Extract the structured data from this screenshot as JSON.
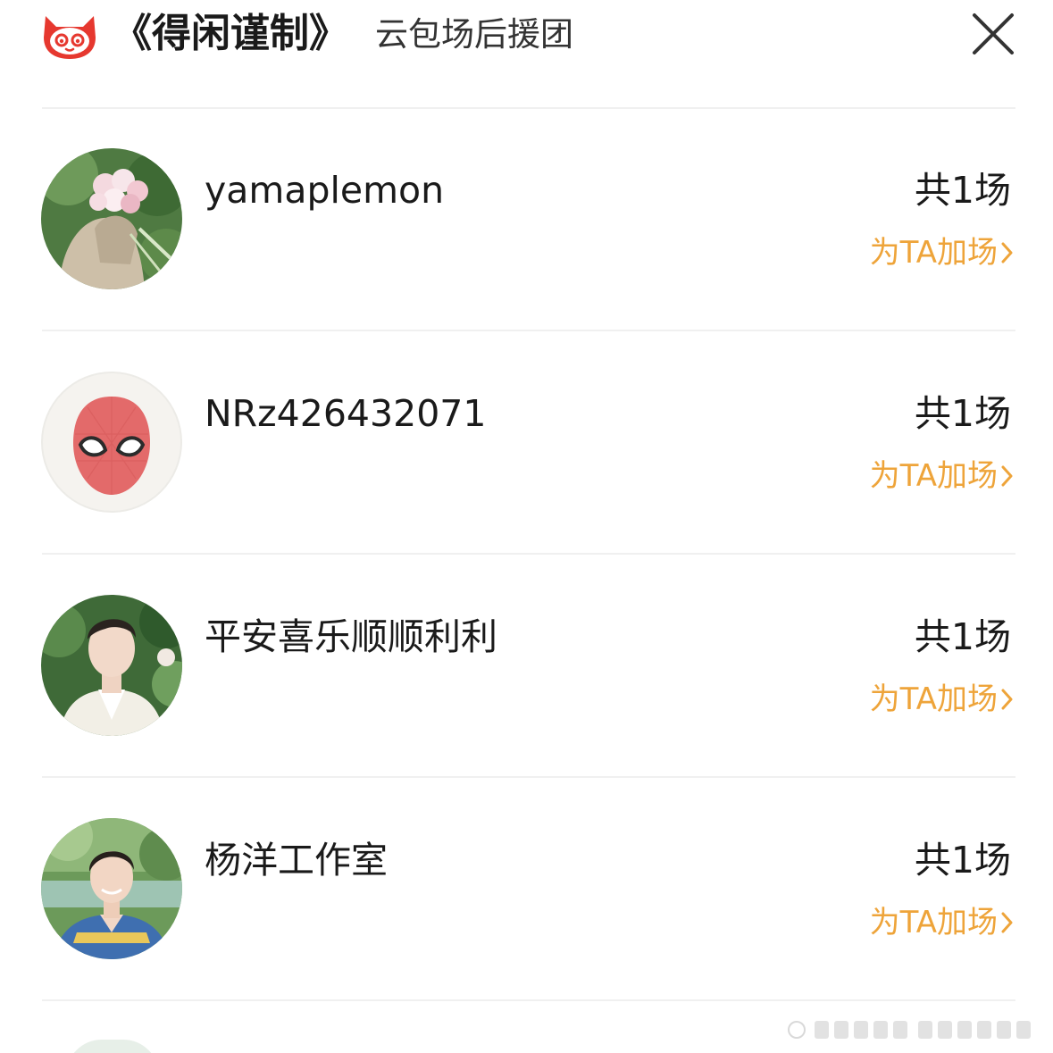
{
  "header": {
    "title": "《得闲谨制》",
    "subtitle": "云包场后援团",
    "logo_icon": "cat-face-icon",
    "close_icon": "close-icon"
  },
  "list": {
    "items": [
      {
        "username": "yamaplemon",
        "count_label": "共1场",
        "action_label": "为TA加场",
        "avatar": "flowers-bouquet-avatar"
      },
      {
        "username": "NRz426432071",
        "count_label": "共1场",
        "action_label": "为TA加场",
        "avatar": "spiderman-mask-avatar"
      },
      {
        "username": "平安喜乐顺顺利利",
        "count_label": "共1场",
        "action_label": "为TA加场",
        "avatar": "man-portrait-avatar"
      },
      {
        "username": "杨洋工作室",
        "count_label": "共1场",
        "action_label": "为TA加场",
        "avatar": "man-smiling-avatar"
      }
    ]
  },
  "colors": {
    "brand_red": "#e6382f",
    "accent_orange": "#eea43a",
    "divider": "#f0f0f0"
  }
}
